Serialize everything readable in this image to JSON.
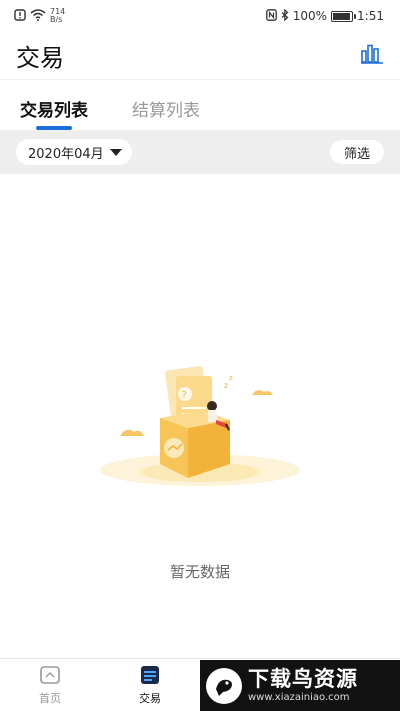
{
  "status_bar": {
    "net_speed_value": "714",
    "net_speed_unit": "B/s",
    "battery": "100%",
    "time": "1:51",
    "battery_level": 1.0
  },
  "header": {
    "title": "交易",
    "stats_icon": "bar-chart-icon"
  },
  "tabs": [
    {
      "label": "交易列表",
      "active": true
    },
    {
      "label": "结算列表",
      "active": false
    }
  ],
  "filter": {
    "date": "2020年04月",
    "button": "筛选"
  },
  "empty": {
    "text": "暂无数据"
  },
  "bottom_nav": [
    {
      "label": "首页",
      "icon": "home-icon",
      "active": false
    },
    {
      "label": "交易",
      "icon": "transaction-icon",
      "active": true
    }
  ],
  "watermark": {
    "title": "下载鸟资源",
    "url": "www.xiazainiao.com"
  },
  "colors": {
    "accent": "#1e6fd9",
    "filter_bg": "#eeeeee",
    "illustration": "#f3c253"
  }
}
